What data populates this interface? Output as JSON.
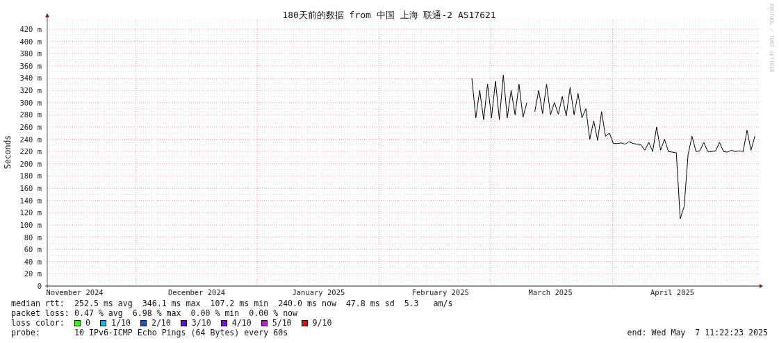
{
  "chart": {
    "credit": "RRDTOOL / TOBI OETIKER",
    "chart_data": {
      "type": "line",
      "title": "180天前的数据 from 中国 上海 联通-2 AS17621",
      "ylabel": "Seconds",
      "categories": [
        null,
        null,
        null,
        null,
        null,
        null,
        null,
        "November 2024",
        null,
        null,
        null,
        null,
        null,
        null,
        null,
        null,
        null,
        null,
        null,
        null,
        null,
        null,
        null,
        null,
        null,
        null,
        null,
        null,
        null,
        null,
        null,
        null,
        null,
        null,
        null,
        null,
        null,
        null,
        "December 2024",
        null,
        null,
        null,
        null,
        null,
        null,
        null,
        null,
        null,
        null,
        null,
        null,
        null,
        null,
        null,
        null,
        null,
        null,
        null,
        null,
        null,
        null,
        null,
        null,
        null,
        null,
        null,
        null,
        null,
        null,
        "January 2025",
        null,
        null,
        null,
        null,
        null,
        null,
        null,
        null,
        null,
        null,
        null,
        null,
        null,
        null,
        null,
        null,
        null,
        null,
        null,
        null,
        null,
        null,
        null,
        null,
        null,
        null,
        null,
        null,
        null,
        null,
        "February 2025",
        null,
        null,
        null,
        null,
        null,
        null,
        null,
        null,
        null,
        null,
        null,
        null,
        null,
        null,
        null,
        null,
        null,
        null,
        null,
        null,
        null,
        null,
        null,
        null,
        null,
        null,
        null,
        "March 2025",
        null,
        null,
        null,
        null,
        null,
        null,
        null,
        null,
        null,
        null,
        null,
        null,
        null,
        null,
        null,
        null,
        null,
        null,
        null,
        null,
        null,
        null,
        null,
        null,
        null,
        null,
        null,
        null,
        null,
        null,
        "April 2025",
        null,
        null,
        null,
        null,
        null,
        null,
        null,
        null,
        null,
        null,
        null,
        null,
        null,
        null,
        null,
        null,
        null,
        null,
        null,
        null,
        null
      ],
      "series": [
        {
          "color": "#000000",
          "values": [
            null,
            null,
            null,
            null,
            null,
            null,
            null,
            null,
            null,
            null,
            null,
            null,
            null,
            null,
            null,
            null,
            null,
            null,
            null,
            null,
            null,
            null,
            null,
            null,
            null,
            null,
            null,
            null,
            null,
            null,
            null,
            null,
            null,
            null,
            null,
            null,
            null,
            null,
            null,
            null,
            null,
            null,
            null,
            null,
            null,
            null,
            null,
            null,
            null,
            null,
            null,
            null,
            null,
            null,
            null,
            null,
            null,
            null,
            null,
            null,
            null,
            null,
            null,
            null,
            null,
            null,
            null,
            null,
            null,
            null,
            null,
            null,
            null,
            null,
            null,
            null,
            null,
            null,
            null,
            null,
            null,
            null,
            null,
            null,
            null,
            null,
            null,
            null,
            null,
            null,
            null,
            null,
            null,
            null,
            null,
            null,
            null,
            null,
            null,
            null,
            null,
            null,
            null,
            null,
            null,
            null,
            null,
            null,
            340,
            275,
            320,
            272,
            330,
            275,
            335,
            272,
            345,
            275,
            320,
            280,
            330,
            276,
            300,
            null,
            285,
            320,
            282,
            330,
            280,
            300,
            281,
            310,
            278,
            325,
            280,
            315,
            275,
            290,
            240,
            270,
            238,
            285,
            245,
            250,
            233,
            233,
            234,
            232,
            236,
            233,
            232,
            231,
            222,
            235,
            220,
            260,
            222,
            240,
            220,
            219,
            218,
            110,
            130,
            215,
            245,
            220,
            221,
            235,
            220,
            220,
            221,
            235,
            220,
            219,
            222,
            220,
            221,
            220,
            255,
            222,
            245
          ]
        }
      ],
      "grid": true,
      "ylim": [
        0,
        420
      ],
      "yticks": [
        {
          "value": 0,
          "label": "0"
        },
        {
          "value": 20,
          "label": "20 m"
        },
        {
          "value": 40,
          "label": "40 m"
        },
        {
          "value": 60,
          "label": "60 m"
        },
        {
          "value": 80,
          "label": "80 m"
        },
        {
          "value": 100,
          "label": "100 m"
        },
        {
          "value": 120,
          "label": "120 m"
        },
        {
          "value": 140,
          "label": "140 m"
        },
        {
          "value": 160,
          "label": "160 m"
        },
        {
          "value": 180,
          "label": "180 m"
        },
        {
          "value": 200,
          "label": "200 m"
        },
        {
          "value": 220,
          "label": "220 m"
        },
        {
          "value": 240,
          "label": "240 m"
        },
        {
          "value": 260,
          "label": "260 m"
        },
        {
          "value": 280,
          "label": "280 m"
        },
        {
          "value": 300,
          "label": "300 m"
        },
        {
          "value": 320,
          "label": "320 m"
        },
        {
          "value": 340,
          "label": "340 m"
        },
        {
          "value": 360,
          "label": "360 m"
        },
        {
          "value": 380,
          "label": "380 m"
        },
        {
          "value": 400,
          "label": "400 m"
        },
        {
          "value": 420,
          "label": "420 m"
        }
      ]
    }
  },
  "legend": {
    "median_rtt": {
      "label": "median rtt:",
      "text": "252.5 ms avg  346.1 ms max  107.2 ms min  240.0 ms now  47.8 ms sd  5.3   am/s"
    },
    "packet_loss": {
      "label": "packet loss:",
      "text": "0.47 % avg  6.98 % max  0.00 % min  0.00 % now"
    },
    "loss_color": {
      "label": "loss color:",
      "items": [
        {
          "label": "0",
          "color": "#26ff00"
        },
        {
          "label": "1/10",
          "color": "#00b8ff"
        },
        {
          "label": "2/10",
          "color": "#0059ff"
        },
        {
          "label": "3/10",
          "color": "#5e00ff"
        },
        {
          "label": "4/10",
          "color": "#7e00ff"
        },
        {
          "label": "5/10",
          "color": "#dd00ff"
        },
        {
          "label": "9/10",
          "color": "#ff0000"
        }
      ]
    },
    "probe": {
      "label": "probe:",
      "text": "10 IPv6-ICMP Echo Pings (64 Bytes) every 60s"
    },
    "end": "end: Wed May  7 11:22:23 2025"
  }
}
